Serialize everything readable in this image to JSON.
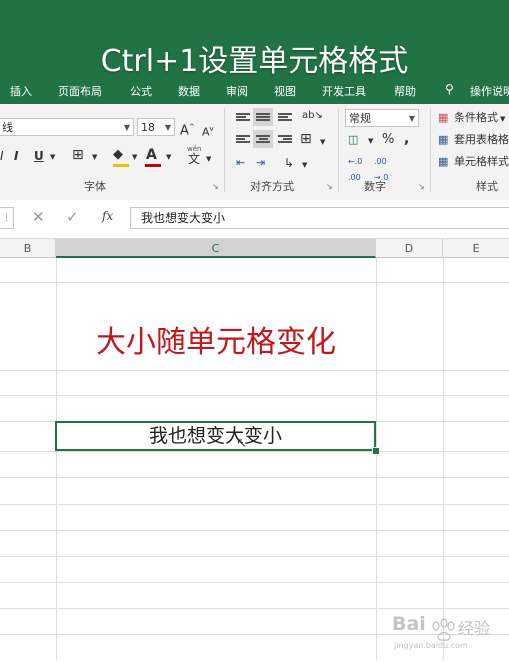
{
  "overlay_title": "Ctrl+1设置单元格格式",
  "tabs": [
    "插入",
    "页面布局",
    "公式",
    "数据",
    "审阅",
    "视图",
    "开发工具",
    "帮助",
    "操作说明"
  ],
  "ribbon": {
    "font_name": "线",
    "font_size": "18",
    "grow_font": "A",
    "shrink_font": "A",
    "bold": "I",
    "underline": "U",
    "font_group_label": "字体",
    "alignment_group_label": "对齐方式",
    "number_format": "常规",
    "number_group_label": "数字",
    "percent": "%",
    "comma": ",",
    "conditional_format": "条件格式",
    "table_format": "套用表格格",
    "cell_styles": "单元格样式",
    "styles_group_label": "样式",
    "wen_label": "wén",
    "wen_char": "文"
  },
  "formula_bar": {
    "fx": "fx",
    "value": "我也想变大变小"
  },
  "columns": [
    "B",
    "C",
    "D",
    "E"
  ],
  "cells": {
    "big_text": "大小随单元格变化",
    "selected_text": "我也想变大变小"
  },
  "watermark": {
    "brand": "Bai",
    "brand_cn": "经验",
    "url": "jingyan.baidu.com"
  },
  "colors": {
    "excel_green": "#217346",
    "red_text": "#c0181c"
  }
}
